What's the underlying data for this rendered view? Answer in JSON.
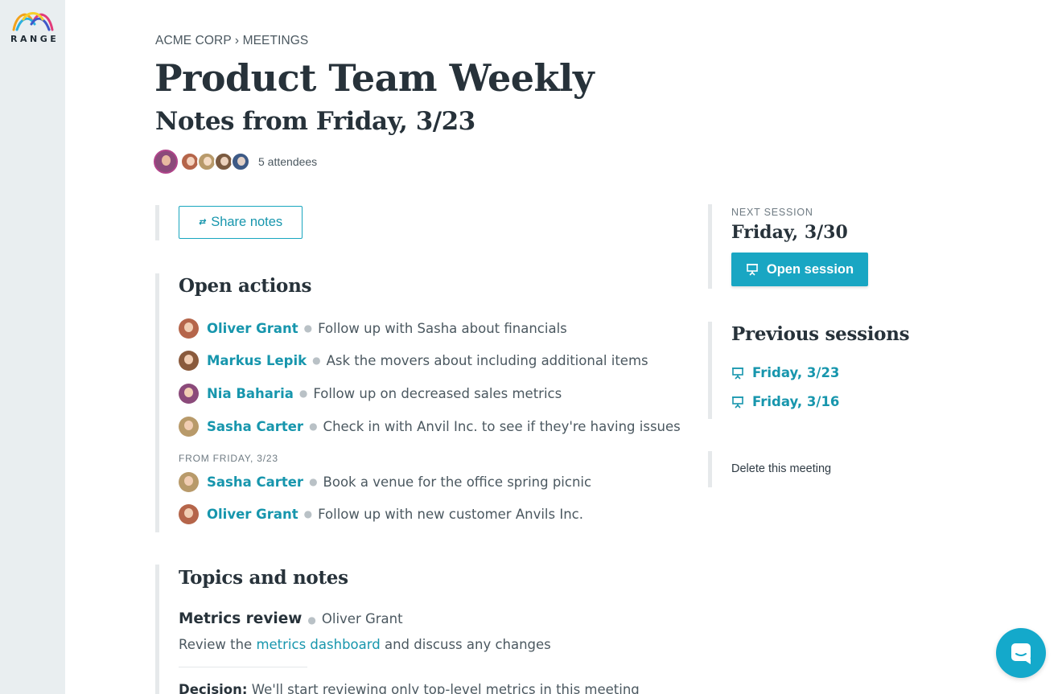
{
  "brand": {
    "name": "RANGE"
  },
  "breadcrumb": {
    "org": "ACME CORP",
    "separator": "›",
    "section": "MEETINGS"
  },
  "meeting": {
    "title": "Product Team Weekly",
    "subtitle": "Notes from Friday, 3/23",
    "attendees_label": "5 attendees"
  },
  "share": {
    "label": "Share notes"
  },
  "open_actions": {
    "title": "Open actions",
    "items": [
      {
        "person": "Oliver Grant",
        "task": "Follow up with Sasha about financials",
        "avatar_color": "#b5654a"
      },
      {
        "person": "Markus Lepik",
        "task": "Ask the movers about including additional items",
        "avatar_color": "#8a5a3c"
      },
      {
        "person": "Nia Baharia",
        "task": "Follow up on decreased sales metrics",
        "avatar_color": "#8b4a7a"
      },
      {
        "person": "Sasha Carter",
        "task": "Check in with Anvil Inc. to see if they're having issues",
        "avatar_color": "#b89a6a"
      }
    ],
    "from_label": "FROM FRIDAY, 3/23",
    "carried_items": [
      {
        "person": "Sasha Carter",
        "task": "Book a venue for the office spring picnic",
        "avatar_color": "#b89a6a"
      },
      {
        "person": "Oliver Grant",
        "task": "Follow up with new customer Anvils Inc.",
        "avatar_color": "#b5654a"
      }
    ]
  },
  "topics": {
    "title": "Topics and notes",
    "items": [
      {
        "title": "Metrics review",
        "owner": "Oliver Grant",
        "desc_before": "Review the",
        "desc_link": "metrics dashboard",
        "desc_after": "and discuss any changes",
        "decision_label": "Decision:",
        "decision_text": "We'll start reviewing only top-level metrics in this meeting"
      }
    ]
  },
  "next_session": {
    "label": "NEXT SESSION",
    "date": "Friday, 3/30",
    "button_label": "Open session"
  },
  "previous_sessions": {
    "title": "Previous sessions",
    "items": [
      "Friday, 3/23",
      "Friday, 3/16"
    ]
  },
  "delete": {
    "label": "Delete this meeting"
  },
  "colors": {
    "accent": "#19a6c3",
    "link": "#1796ad",
    "sidebar": "#e9eef0",
    "text": "#27323a"
  }
}
